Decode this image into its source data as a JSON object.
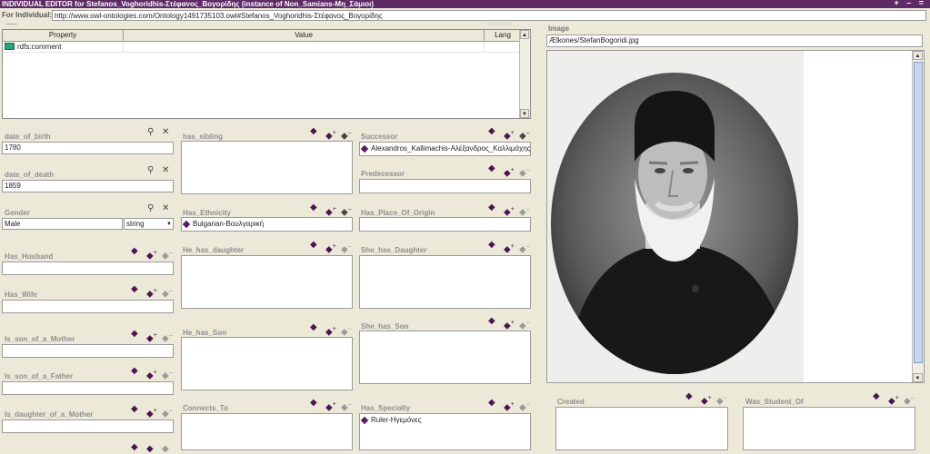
{
  "window": {
    "title": "INDIVIDUAL EDITOR for Stefanos_Voghoridhis-Στέφανος_Βογορίδης   (instance of Non_Samians-Μη_Σάμιοι)",
    "controls": "+ – ="
  },
  "individual": {
    "label": "For Individual:",
    "uri": "http://www.owl-ontologies.com/Ontology1491735103.owl#Stefanos_Voghoridhis-Στέφανος_Βογορίδης"
  },
  "props_table": {
    "columns": [
      "Property",
      "Value",
      "Lang"
    ],
    "rows": [
      {
        "property": "rdfs:comment",
        "value": "",
        "lang": ""
      }
    ]
  },
  "image": {
    "label": "Image",
    "path": "Ælkones/StefanBogoridi.jpg"
  },
  "fields": {
    "date_of_birth": {
      "label": "date_of_birth",
      "value": "1780"
    },
    "date_of_death": {
      "label": "date_of_death",
      "value": "1859"
    },
    "gender": {
      "label": "Gender",
      "value": "Male",
      "type": "string"
    },
    "has_husband": {
      "label": "Has_Husband"
    },
    "has_wife": {
      "label": "Has_Wife"
    },
    "is_son_of_a_mother": {
      "label": "Is_son_of_a_Mother"
    },
    "is_son_of_a_father": {
      "label": "Is_son_of_a_Father"
    },
    "is_daughter_of_a_mother": {
      "label": "Is_daughter_of_a_Mother"
    },
    "has_sibling": {
      "label": "has_sibling"
    },
    "has_ethnicity": {
      "label": "Has_Ethnicity",
      "value": "Bulgarian-Βουλγαρική"
    },
    "he_has_daughter": {
      "label": "He_has_daughter"
    },
    "he_has_son": {
      "label": "He_has_Son"
    },
    "connects_to": {
      "label": "Connects_To"
    },
    "successor": {
      "label": "Successor",
      "value": "Alexandros_Kallimachis-Αλέξανδρος_Καλλιμάχης"
    },
    "predecessor": {
      "label": "Predecessor"
    },
    "has_place_of_origin": {
      "label": "Has_Place_Of_Origin"
    },
    "she_has_daughter": {
      "label": "She_has_Daughter"
    },
    "she_has_son": {
      "label": "She_has_Son"
    },
    "has_specialty": {
      "label": "Has_Specialty",
      "value": "Ruler-Ηγεμόνες"
    },
    "created": {
      "label": "Created"
    },
    "was_student_of": {
      "label": "Was_Student_Of"
    }
  },
  "icons": {
    "search": "⚲",
    "delete": "✕",
    "create": "◆",
    "add": "◆+",
    "remove": "◆–"
  },
  "colors": {
    "title_bar": "#5f2a66",
    "instance_marker": "#5a1e5e",
    "panel_bg": "#ece9d8",
    "label_gray": "#8f8f8f"
  }
}
